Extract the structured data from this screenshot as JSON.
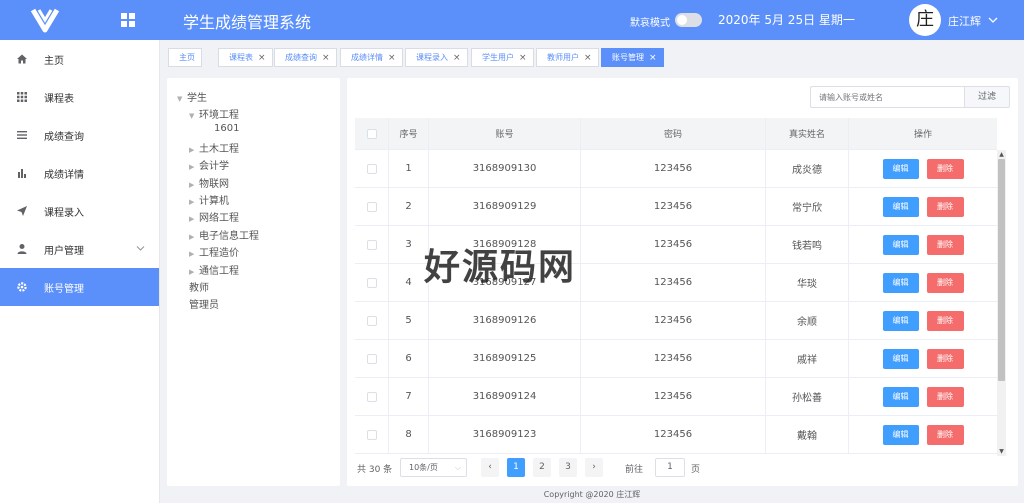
{
  "header": {
    "title": "学生成绩管理系统",
    "mode_label": "默哀模式",
    "date": "2020年 5月 25日   星期一",
    "avatar_char": "庄",
    "user_name": "庄江辉",
    "brand_color": "#5b8ff9"
  },
  "sidebar": {
    "items": [
      {
        "label": "主页",
        "icon": "home-icon"
      },
      {
        "label": "课程表",
        "icon": "grid-icon"
      },
      {
        "label": "成绩查询",
        "icon": "list-icon"
      },
      {
        "label": "成绩详情",
        "icon": "bar-chart-icon"
      },
      {
        "label": "课程录入",
        "icon": "send-icon"
      },
      {
        "label": "用户管理",
        "icon": "user-icon"
      },
      {
        "label": "账号管理",
        "icon": "gear-icon",
        "active": true
      }
    ]
  },
  "tabs": [
    {
      "label": "主页"
    },
    {
      "label": "课程表",
      "x": "×"
    },
    {
      "label": "成绩查询",
      "x": "×"
    },
    {
      "label": "成绩详情",
      "x": "×"
    },
    {
      "label": "课程录入",
      "x": "×"
    },
    {
      "label": "学生用户",
      "x": "×"
    },
    {
      "label": "教师用户",
      "x": "×"
    },
    {
      "label": "账号管理",
      "x": "×",
      "active": true
    }
  ],
  "tree": {
    "root": "学生",
    "expanded": "环境工程",
    "expanded_child": "1601",
    "collapsed": [
      "土木工程",
      "会计学",
      "物联网",
      "计算机",
      "网络工程",
      "电子信息工程",
      "工程造价",
      "通信工程"
    ],
    "others": [
      "教师",
      "管理员"
    ]
  },
  "filter": {
    "placeholder": "请输入账号或姓名",
    "button": "过滤"
  },
  "table": {
    "columns": [
      "序号",
      "账号",
      "密码",
      "真实姓名",
      "操作"
    ],
    "edit_label": "编辑",
    "delete_label": "删除",
    "rows": [
      {
        "no": "1",
        "account": "3168909130",
        "password": "123456",
        "name": "成炎德"
      },
      {
        "no": "2",
        "account": "3168909129",
        "password": "123456",
        "name": "常宁欣"
      },
      {
        "no": "3",
        "account": "3168909128",
        "password": "123456",
        "name": "钱若鸣"
      },
      {
        "no": "4",
        "account": "3168909127",
        "password": "123456",
        "name": "华琰"
      },
      {
        "no": "5",
        "account": "3168909126",
        "password": "123456",
        "name": "余顺"
      },
      {
        "no": "6",
        "account": "3168909125",
        "password": "123456",
        "name": "戚祥"
      },
      {
        "no": "7",
        "account": "3168909124",
        "password": "123456",
        "name": "孙松善"
      },
      {
        "no": "8",
        "account": "3168909123",
        "password": "123456",
        "name": "戴翰"
      }
    ]
  },
  "pagination": {
    "total": "共 30 条",
    "page_size": "10条/页",
    "prev": "‹",
    "next": "›",
    "pages": [
      "1",
      "2",
      "3"
    ],
    "goto_label": "前往",
    "goto_value": "1",
    "page_suffix": "页"
  },
  "footer": "Copyright @2020 庄江辉",
  "watermark": "好源码网"
}
